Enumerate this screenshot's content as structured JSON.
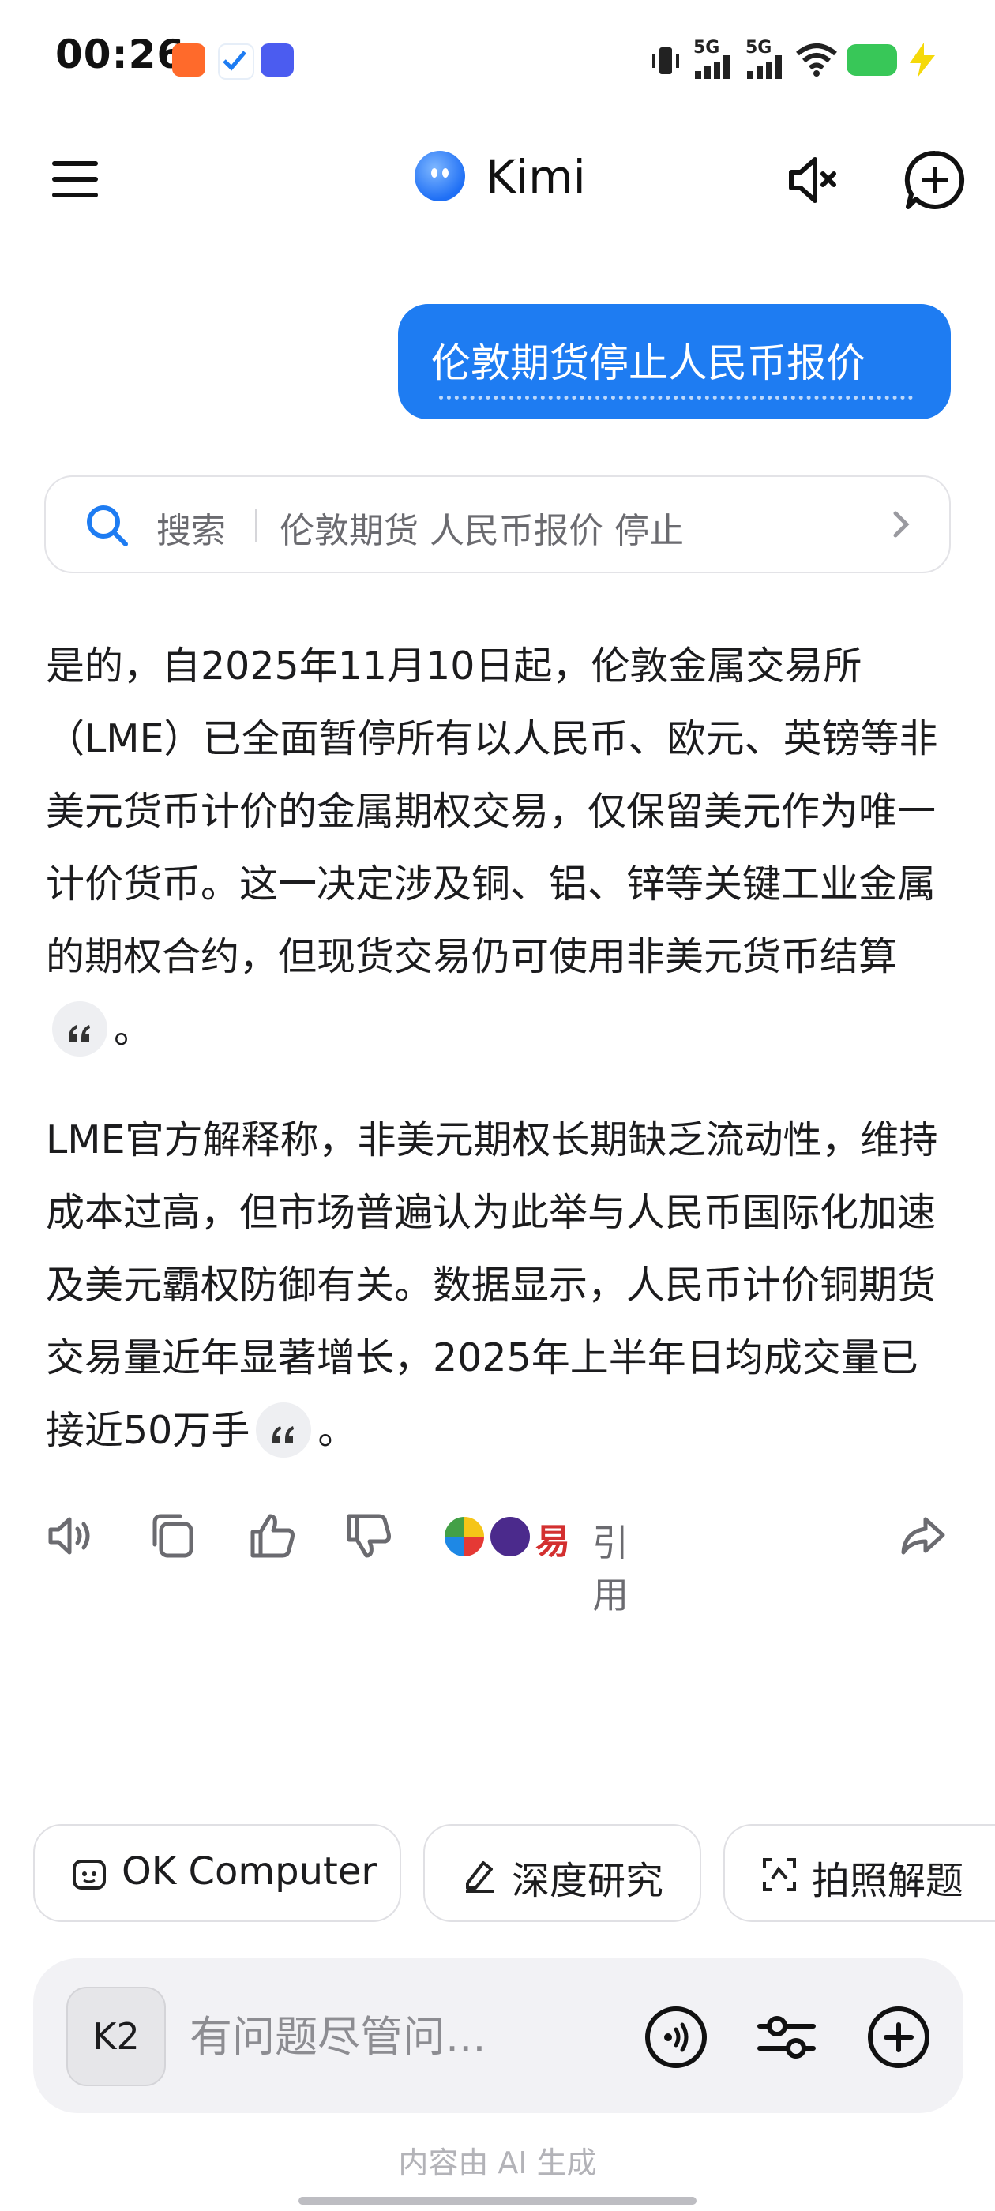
{
  "status_bar": {
    "time": "00:26",
    "network_1": "5G",
    "network_2": "5G"
  },
  "header": {
    "title": "Kimi",
    "menu_icon": "menu-icon",
    "sound_icon": "speaker-muted-icon",
    "new_chat_icon": "chat-plus-icon"
  },
  "user_message": {
    "text": "伦敦期货停止人民币报价"
  },
  "search_chip": {
    "label": "搜索",
    "query": "伦敦期货 人民币报价 停止"
  },
  "answer": {
    "para1": "是的，自2025年11月10日起，伦敦金属交易所（LME）已全面暂停所有以人民币、欧元、英镑等非美元货币计价的金属期权交易，仅保留美元作为唯一计价货币。这一决定涉及铜、铝、锌等关键工业金属的期权合约，但现货交易仍可使用非美元货币结算",
    "para1_end": "。",
    "para2": "LME官方解释称，非美元期权长期缺乏流动性，维持成本过高，但市场普遍认为此举与人民币国际化加速及美元霸权防御有关。数据显示，人民币计价铜期货交易量近年显著增长，2025年上半年日均成交量已接近50万手",
    "para2_end": "。"
  },
  "actions": {
    "cite_label": "引用",
    "cite_source_3": "易"
  },
  "quick_chips": [
    {
      "label": "OK Computer",
      "icon": "robot-face-icon"
    },
    {
      "label": "深度研究",
      "icon": "research-pen-icon"
    },
    {
      "label": "拍照解题",
      "icon": "scan-icon"
    }
  ],
  "input": {
    "model_label": "K2",
    "placeholder": "有问题尽管问..."
  },
  "footer": {
    "disclaimer": "内容由 AI 生成"
  },
  "colors": {
    "accent": "#1e7cf2",
    "battery": "#38c758",
    "charging": "#f5d90a"
  }
}
